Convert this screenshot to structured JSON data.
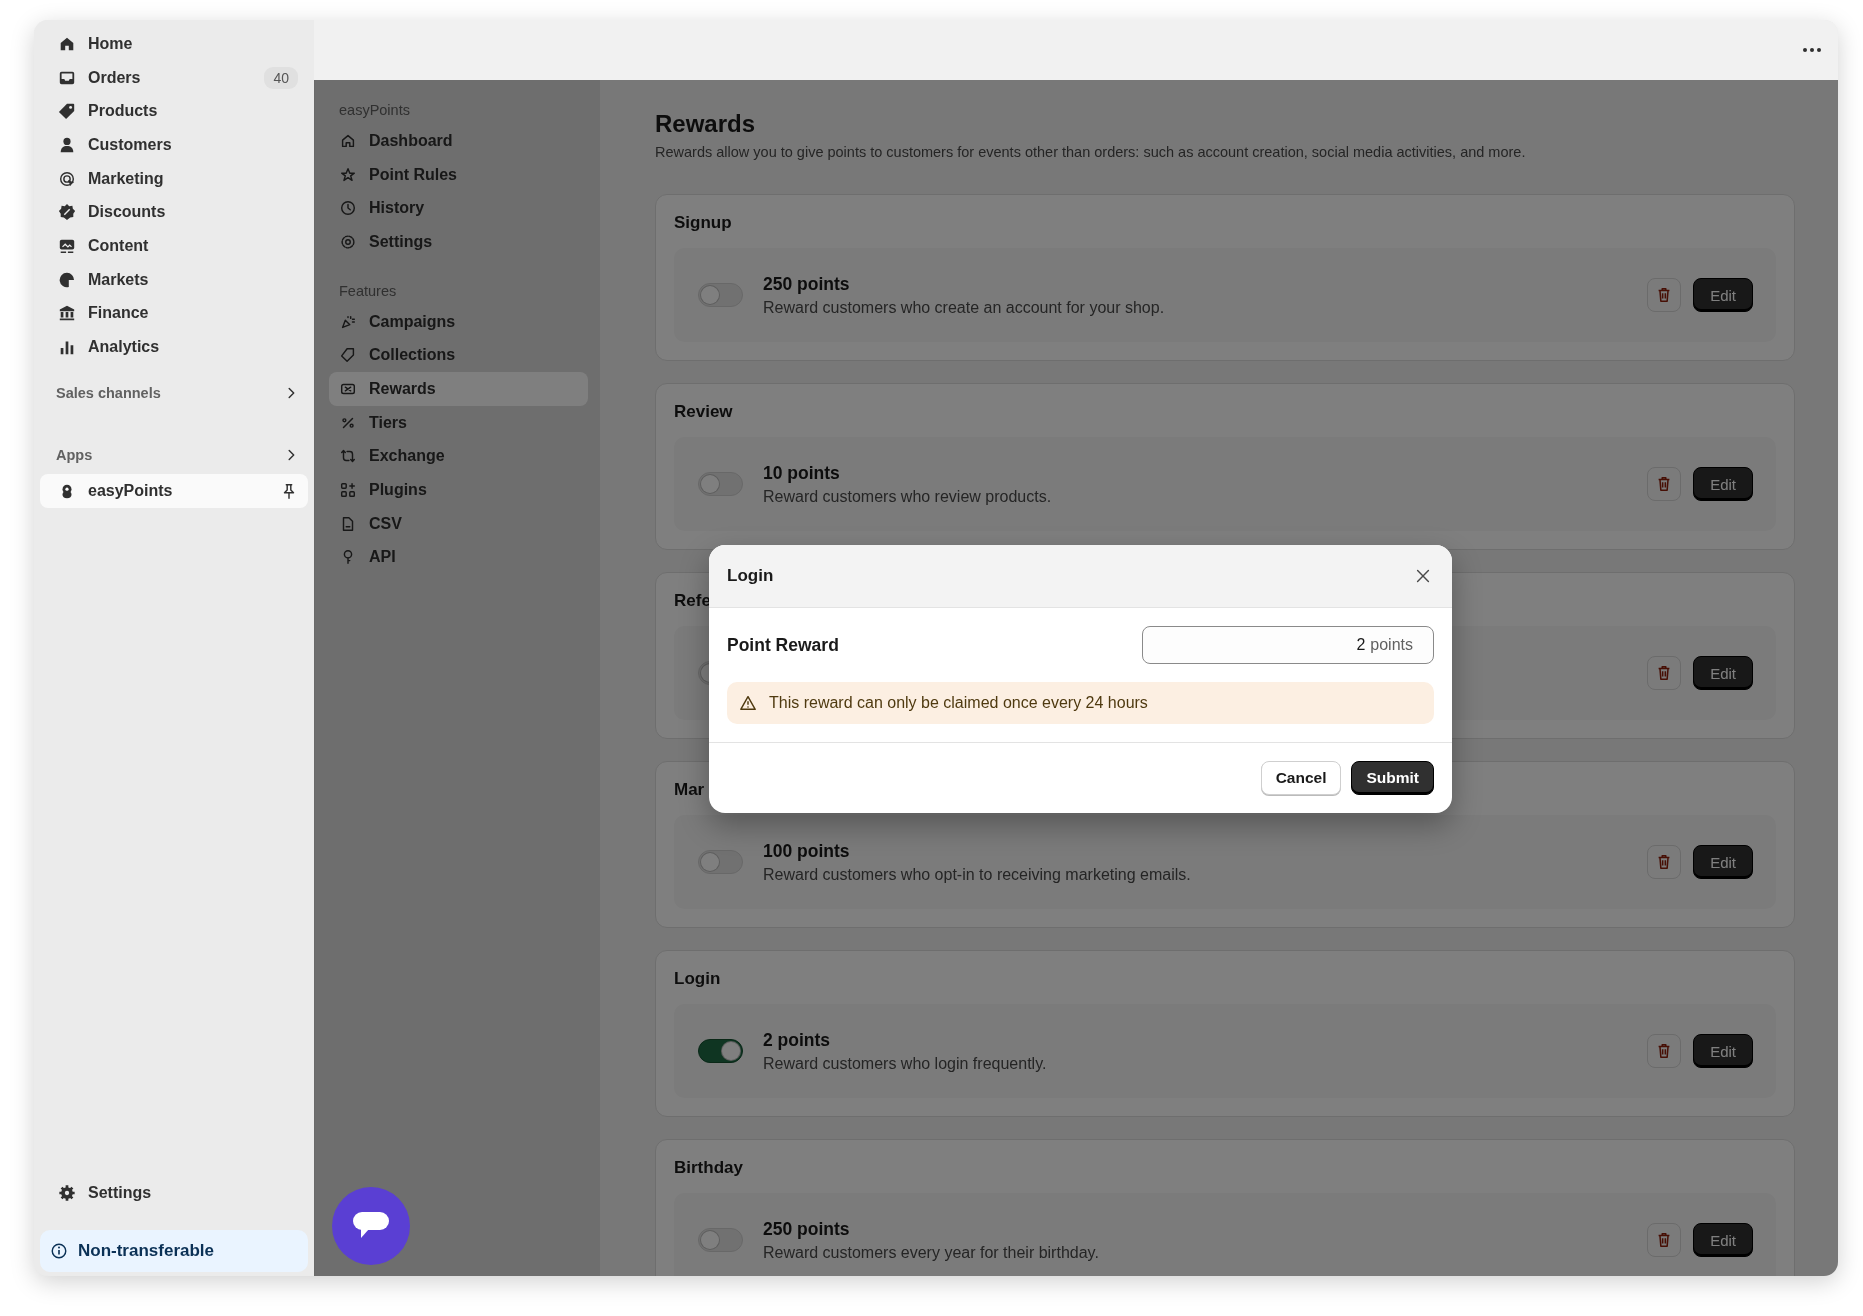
{
  "admin_sidebar": {
    "items": [
      {
        "label": "Home"
      },
      {
        "label": "Orders",
        "badge": "40"
      },
      {
        "label": "Products"
      },
      {
        "label": "Customers"
      },
      {
        "label": "Marketing"
      },
      {
        "label": "Discounts"
      },
      {
        "label": "Content"
      },
      {
        "label": "Markets"
      },
      {
        "label": "Finance"
      },
      {
        "label": "Analytics"
      }
    ],
    "sections": [
      {
        "label": "Sales channels"
      },
      {
        "label": "Apps"
      }
    ],
    "apps": [
      {
        "label": "easyPoints",
        "selected": true
      }
    ],
    "settings": "Settings",
    "notice": "Non-transferable"
  },
  "app_nav": {
    "groups": [
      {
        "heading": "easyPoints",
        "items": [
          {
            "label": "Dashboard",
            "selected": false
          },
          {
            "label": "Point Rules",
            "selected": false
          },
          {
            "label": "History",
            "selected": false
          },
          {
            "label": "Settings",
            "selected": false
          }
        ]
      },
      {
        "heading": "Features",
        "items": [
          {
            "label": "Campaigns",
            "selected": false
          },
          {
            "label": "Collections",
            "selected": false
          },
          {
            "label": "Rewards",
            "selected": true
          },
          {
            "label": "Tiers",
            "selected": false
          },
          {
            "label": "Exchange",
            "selected": false
          },
          {
            "label": "Plugins",
            "selected": false
          },
          {
            "label": "CSV",
            "selected": false
          },
          {
            "label": "API",
            "selected": false
          }
        ]
      }
    ]
  },
  "page": {
    "title": "Rewards",
    "description": "Rewards allow you to give points to customers for events other than orders: such as account creation, social media activities, and more.",
    "cards": [
      {
        "title": "Signup",
        "rows": [
          {
            "points": "250 points",
            "description": "Reward customers who create an account for your shop.",
            "on": false,
            "edit": "Edit"
          }
        ]
      },
      {
        "title": "Review",
        "rows": [
          {
            "points": "10 points",
            "description": "Reward customers who review products.",
            "on": false,
            "edit": "Edit"
          }
        ]
      },
      {
        "title": "Refe",
        "rows": [
          {
            "on": false,
            "edit": "Edit"
          }
        ]
      },
      {
        "title": "Mar",
        "rows": [
          {
            "points": "100 points",
            "description": "Reward customers who opt-in to receiving marketing emails.",
            "on": false,
            "edit": "Edit"
          }
        ]
      },
      {
        "title": "Login",
        "rows": [
          {
            "points": "2 points",
            "description": "Reward customers who login frequently.",
            "on": true,
            "edit": "Edit"
          }
        ]
      },
      {
        "title": "Birthday",
        "rows": [
          {
            "points": "250 points",
            "description": "Reward customers every year for their birthday.",
            "on": false,
            "edit": "Edit"
          }
        ]
      }
    ]
  },
  "modal": {
    "title": "Login",
    "field_label": "Point Reward",
    "value": "2",
    "unit": "points",
    "warning": "This reward can only be claimed once every 24 hours",
    "buttons": [
      {
        "label": "Cancel",
        "kind": "secondary"
      },
      {
        "label": "Submit",
        "kind": "primary"
      }
    ]
  }
}
